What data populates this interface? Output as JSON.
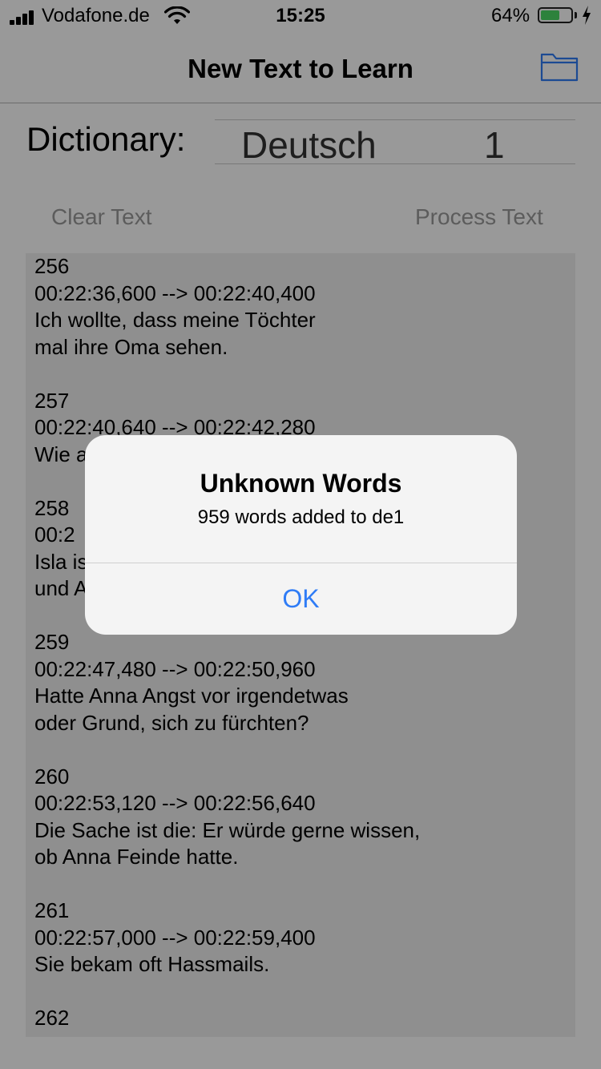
{
  "status_bar": {
    "carrier": "Vodafone.de",
    "time": "15:25",
    "battery_percent": "64%",
    "battery_level": 0.64
  },
  "nav": {
    "title": "New Text to Learn",
    "folder_icon": "folder-icon"
  },
  "dictionary": {
    "label": "Dictionary:",
    "language": "Deutsch",
    "number": "1"
  },
  "actions": {
    "clear_label": "Clear Text",
    "process_label": "Process Text"
  },
  "text_area": {
    "content": "256\n00:22:36,600 --> 00:22:40,400\nIch wollte, dass meine Töchter\nmal ihre Oma sehen.\n\n257\n00:22:40,640 --> 00:22:42,280\nWie a\n\n258\n00:2\nIsla is\nund A\n\n259\n00:22:47,480 --> 00:22:50,960\nHatte Anna Angst vor irgendetwas\noder Grund, sich zu fürchten?\n\n260\n00:22:53,120 --> 00:22:56,640\nDie Sache ist die: Er würde gerne wissen,\nob Anna Feinde hatte.\n\n261\n00:22:57,000 --> 00:22:59,400\nSie bekam oft Hassmails.\n\n262"
  },
  "alert": {
    "title": "Unknown Words",
    "message": "959 words added to de1",
    "ok_label": "OK"
  },
  "colors": {
    "accent": "#2f7cf6",
    "battery": "#4cd964",
    "disabled_text": "#9a9a9a"
  }
}
